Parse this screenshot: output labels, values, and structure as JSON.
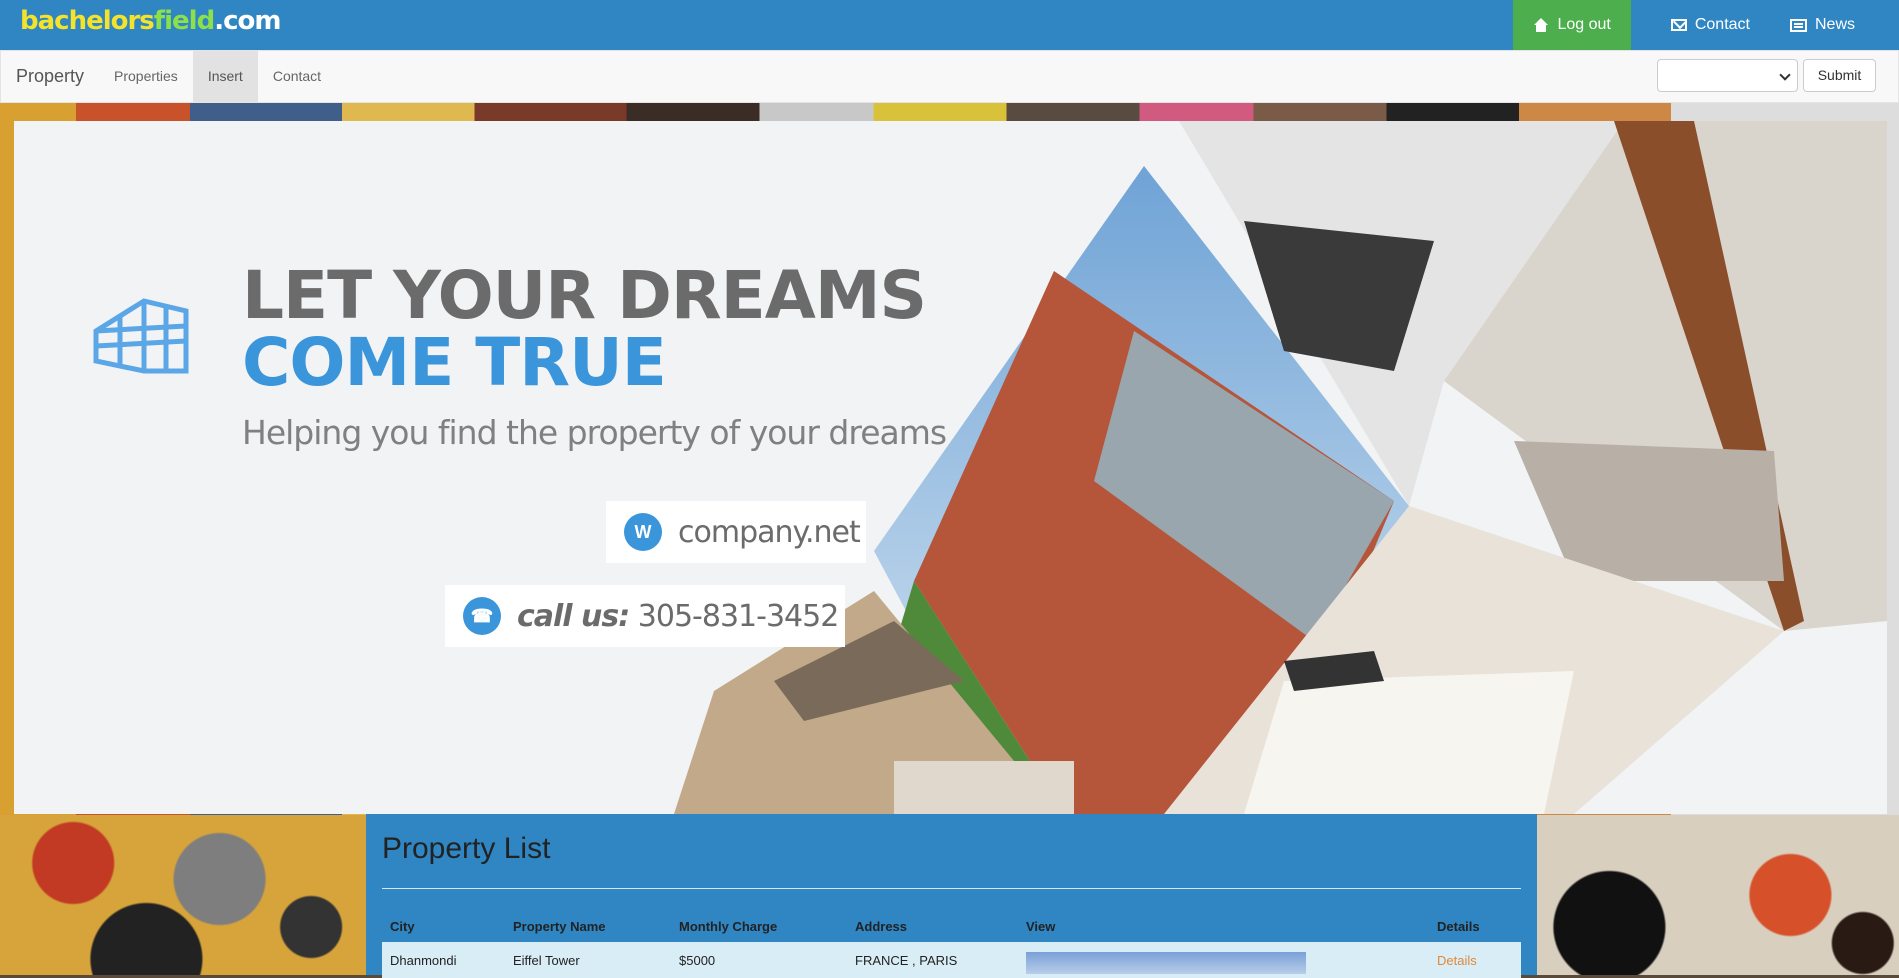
{
  "topbar": {
    "logo": {
      "part1": "bachelors",
      "part2": "field",
      "part3": ".com"
    },
    "links": [
      {
        "label": "Log out",
        "icon": "home-icon",
        "active": true
      },
      {
        "label": "Contact",
        "icon": "envelope-icon"
      },
      {
        "label": "News",
        "icon": "newspaper-icon"
      }
    ]
  },
  "navbar": {
    "brand": "Property",
    "items": [
      {
        "label": "Properties"
      },
      {
        "label": "Insert",
        "active": true
      },
      {
        "label": "Contact"
      }
    ],
    "select_value": "",
    "submit_label": "Submit"
  },
  "banner": {
    "headline1": "LET YOUR DREAMS",
    "headline2": "COME TRUE",
    "subheadline": "Helping you find the property of your dreams",
    "website_icon_letter": "W",
    "website": "company.net",
    "call_label": "call us:",
    "phone": "305-831-3452",
    "accent_color": "#3a95db"
  },
  "property_list": {
    "title": "Property List",
    "columns": [
      "City",
      "Property Name",
      "Monthly Charge",
      "Address",
      "View",
      "Details"
    ],
    "rows": [
      {
        "city": "Dhanmondi",
        "name": "Eiffel Tower",
        "charge": "$5000",
        "address": "FRANCE , PARIS",
        "details": "Details"
      }
    ]
  },
  "colors": {
    "primary": "#2f86c3",
    "success": "#4cae4c",
    "link": "#e0893a"
  }
}
